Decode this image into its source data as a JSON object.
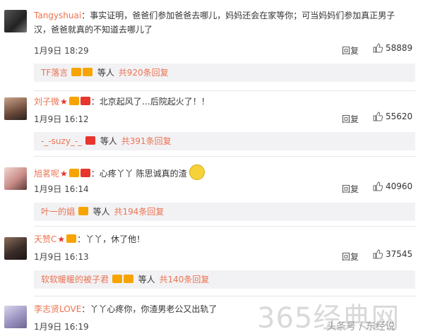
{
  "comments": [
    {
      "username": "Tangyshuai",
      "text_line1": "事实证明，爸爸们参加爸爸去哪儿，妈妈还会在家等你；可当妈妈们参加真正男子",
      "text_line2": "汉，爸爸就真的不知道去哪儿了",
      "time": "1月9日 18:29",
      "reply": "回复",
      "likes": "58889",
      "sub_reply": {
        "names": "TF落言",
        "wait": "等人",
        "count": "共920条回复"
      }
    },
    {
      "username": "刘子微",
      "text": "北京起风了…后院起火了！！",
      "time": "1月9日 16:12",
      "reply": "回复",
      "likes": "55620",
      "sub_reply": {
        "names": "-_-suzy_-_",
        "wait": "等人",
        "count": "共391条回复"
      }
    },
    {
      "username": "旭茗呢",
      "text": "心疼丫丫 陈思诚真的渣",
      "time": "1月9日 16:14",
      "reply": "回复",
      "likes": "40960",
      "sub_reply": {
        "names": "叶一的娼",
        "wait": "等人",
        "count": "共194条回复"
      }
    },
    {
      "username": "天赞C",
      "text": "丫丫，休了他！",
      "time": "1月9日 16:13",
      "reply": "回复",
      "likes": "37545",
      "sub_reply": {
        "names": "软软暖暖的被子君",
        "wait": "等人",
        "count": "共140条回复"
      }
    },
    {
      "username": "李志贤LOVE",
      "text": "丫丫心疼你，你渣男老公又出轨了",
      "time": "1月9日 16:19",
      "reply": "回复",
      "likes": ""
    }
  ],
  "colon": "：",
  "watermark": "365经典网",
  "credit": "头条号 / 东经说",
  "colors": {
    "name": "#eb7350",
    "subbox": "#f2f2f5"
  }
}
